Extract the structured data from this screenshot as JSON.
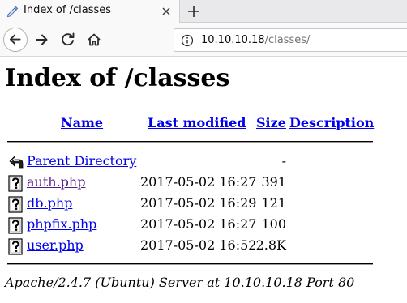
{
  "browser": {
    "tab": {
      "title": "Index of /classes",
      "icon": "pencil-page-icon"
    },
    "url": {
      "host": "10.10.10.18",
      "path": "/classes/"
    },
    "chrome_colors": {
      "tabbar": "#e9e9eb",
      "toolbar": "#f9f9fa"
    }
  },
  "page": {
    "title": "Index of /classes",
    "columns": {
      "name": "Name",
      "last_modified": "Last modified",
      "size": "Size",
      "description": "Description"
    },
    "rows": [
      {
        "name": "Parent Directory",
        "date": "",
        "size": "-",
        "icon": "back-folder-icon"
      },
      {
        "name": "auth.php",
        "date": "2017-05-02 16:27",
        "size": "391",
        "icon": "unknown-file-icon"
      },
      {
        "name": "db.php",
        "date": "2017-05-02 16:29",
        "size": "121",
        "icon": "unknown-file-icon"
      },
      {
        "name": "phpfix.php",
        "date": "2017-05-02 16:27",
        "size": "100",
        "icon": "unknown-file-icon"
      },
      {
        "name": "user.php",
        "date": "2017-05-02 16:52",
        "size": "2.8K",
        "icon": "unknown-file-icon"
      }
    ],
    "footer": "Apache/2.4.7 (Ubuntu) Server at 10.10.10.18 Port 80",
    "link_color": "#0000ee",
    "visited_link_color": "#551a8b"
  }
}
